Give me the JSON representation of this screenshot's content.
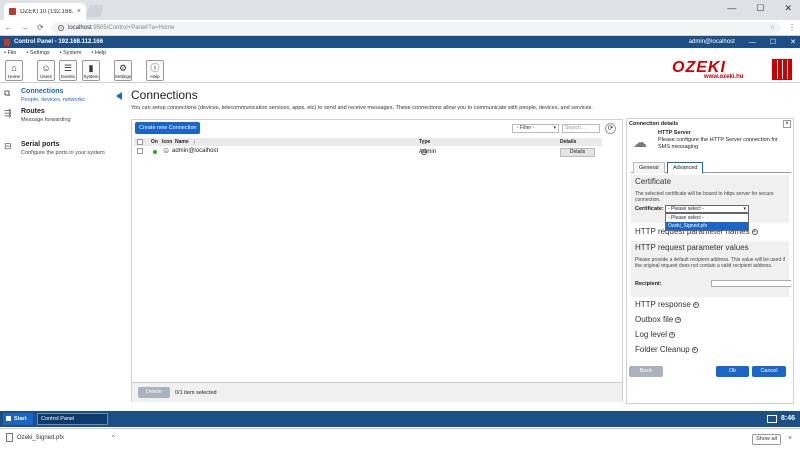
{
  "browser": {
    "tab_title": "OZEKI 10 (192.168.112.1",
    "tab_close": "×",
    "window_controls": [
      "—",
      "☐",
      "✕"
    ],
    "url_host": "localhost",
    "url_path": ":9505/Control+Panel/?a=Home",
    "back": "←",
    "forward": "→",
    "reload": "⟳",
    "star": "☆",
    "menu": "⋮"
  },
  "app": {
    "title": "Control Panel - 192.168.112.166",
    "user": "admin@localhost",
    "window_controls": [
      "—",
      "☐",
      "✕"
    ]
  },
  "menu": [
    "• File",
    "• Settings",
    "• System",
    "• Help"
  ],
  "toolbar": [
    {
      "label": "Home",
      "icon": "home-icon",
      "glyph": "⌂"
    },
    {
      "label": "Users",
      "icon": "users-icon",
      "glyph": "☺"
    },
    {
      "label": "Events",
      "icon": "events-icon",
      "glyph": "☰"
    },
    {
      "label": "System",
      "icon": "system-icon",
      "glyph": "▮"
    },
    {
      "label": "Settings",
      "icon": "settings-icon",
      "glyph": "⚙"
    },
    {
      "label": "Help",
      "icon": "help-icon",
      "glyph": "ⓘ"
    }
  ],
  "brand": {
    "word": "OZEKI",
    "site": "www.ozeki.hu"
  },
  "sidebar": [
    {
      "title": "Connections",
      "subtitle": "People, devices, networks",
      "icon": "connections-icon",
      "glyph": "⧉",
      "active": true
    },
    {
      "title": "Routes",
      "subtitle": "Message forwarding",
      "icon": "routes-icon",
      "glyph": "⇶",
      "active": false
    },
    {
      "title": "Serial ports",
      "subtitle": "Configure the ports in your system",
      "icon": "serial-port-icon",
      "glyph": "⊟",
      "active": false
    }
  ],
  "main": {
    "title": "Connections",
    "description": "You can setup connections (devices, telecommunication services, apps, etc) to send and receive messages. These connections allow you to communicate with people, devices, and services.",
    "create_button": "Create new Connection",
    "filter": "- Filter -",
    "filter_arrow": "▾",
    "search_placeholder": "Search...",
    "refresh": "⟳",
    "columns": {
      "on": "On",
      "icon": "Icon",
      "name": "Name",
      "type": "Type",
      "details": "Details"
    },
    "sort_indicator": "↓",
    "rows": [
      {
        "name": "admin@localhost",
        "type": "Admin",
        "details": "Details",
        "help": "?"
      }
    ],
    "delete_button": "Delete",
    "selection_info": "0/1 item selected"
  },
  "details": {
    "header": "Connection details",
    "close": "×",
    "server_title": "HTTP Server",
    "server_desc": "Please configure the HTTP Server connection for SMS messaging",
    "tabs": [
      "General",
      "Advanced"
    ],
    "active_tab": "Advanced",
    "certificate": {
      "heading": "Certificate",
      "desc": "The selected certificate will be bound to https server for secure connection.",
      "label": "Certificate:",
      "selected": "- Please select -",
      "options": [
        "- Please select -",
        "Ozeki_Signed.pfx"
      ]
    },
    "request_names": "HTTP request parameter names",
    "request_values": {
      "heading": "HTTP request parameter values",
      "desc": "Please provide a default recipient address. This value will be used if the original request does not contain a valid recipient address.",
      "label": "Recipient:",
      "value": ""
    },
    "collapsed_sections": [
      "HTTP response",
      "Outbox file",
      "Log level",
      "Folder Cleanup"
    ],
    "plus": "+",
    "back": "Back",
    "ok": "Ok",
    "cancel": "Cancel"
  },
  "taskbar": {
    "start": "Start",
    "item": "Control Panel",
    "time": "8:46"
  },
  "downloads": {
    "file": "Ozeki_Signed.pfx",
    "chevron": "^",
    "show_all": "Show all",
    "close": "×"
  },
  "colors": {
    "accent": "#1a66c8",
    "title_bar": "#1c4f86",
    "brand": "#cc0000"
  }
}
